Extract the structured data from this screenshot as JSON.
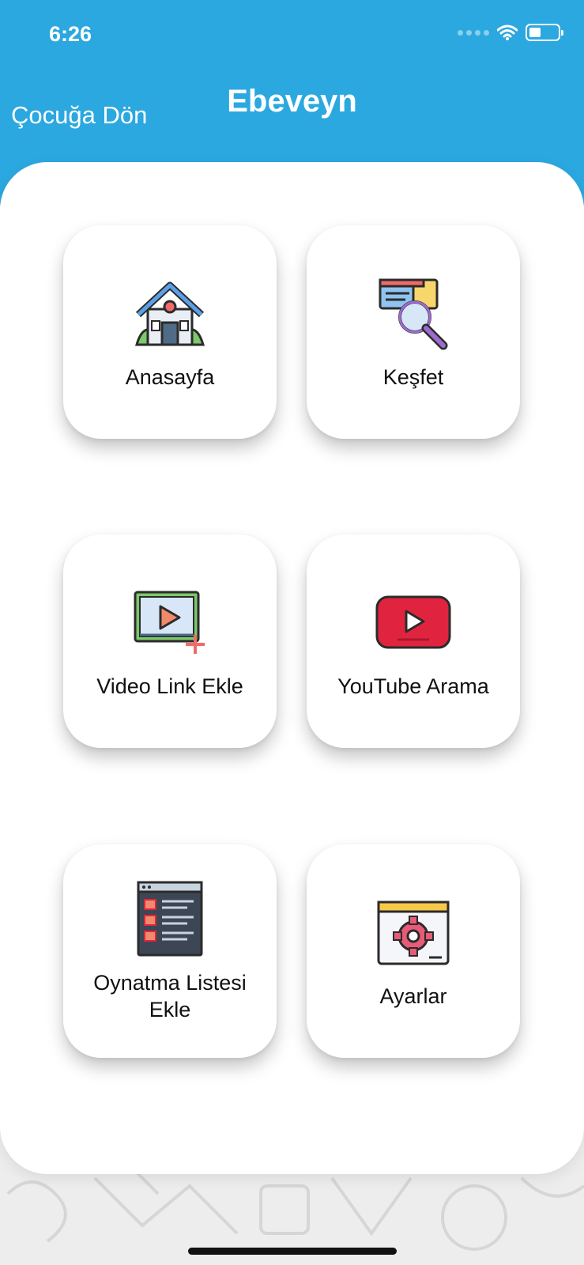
{
  "status_bar": {
    "time": "6:26"
  },
  "header": {
    "back_label": "Çocuğa Dön",
    "title": "Ebeveyn",
    "background_color": "#2ba8e0"
  },
  "menu": {
    "items": [
      {
        "label": "Anasayfa",
        "icon": "home-icon"
      },
      {
        "label": "Keşfet",
        "icon": "discover-search-icon"
      },
      {
        "label": "Video Link Ekle",
        "icon": "add-video-link-icon"
      },
      {
        "label": "YouTube Arama",
        "icon": "youtube-icon"
      },
      {
        "label": "Oynatma Listesi Ekle",
        "icon": "playlist-icon"
      },
      {
        "label": "Ayarlar",
        "icon": "settings-gear-icon"
      }
    ]
  }
}
